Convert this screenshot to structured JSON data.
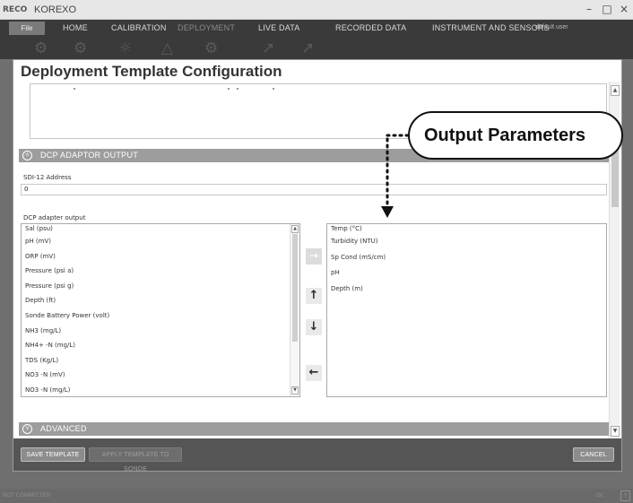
{
  "window": {
    "logo": "RECO",
    "title": "KOREXO",
    "minimize": "–",
    "maximize": "□",
    "close": "×"
  },
  "ribbon": {
    "file": "File",
    "tabs": [
      {
        "label": "HOME"
      },
      {
        "label": "CALIBRATION"
      },
      {
        "label": "DEPLOYMENT"
      },
      {
        "label": "LIVE DATA"
      },
      {
        "label": "RECORDED DATA"
      },
      {
        "label": "INSTRUMENT AND SENSORS"
      }
    ],
    "user": "default user"
  },
  "dialog": {
    "title": "Deployment Template Configuration",
    "dcp_section": "DCP ADAPTOR OUTPUT",
    "sdi_label": "SDI-12 Address",
    "sdi_value": "0",
    "dcp_output_label": "DCP adapter output",
    "available_parameters": [
      "Sal (psu)",
      "pH (mV)",
      "ORP (mV)",
      "Pressure (psi a)",
      "Pressure (psi g)",
      "Depth (ft)",
      "Sonde Battery Power (volt)",
      "NH3 (mg/L)",
      "NH4+ -N (mg/L)",
      "TDS (Kg/L)",
      "NO3 -N (mV)",
      "NO3 -N (mg/L)"
    ],
    "selected_parameters": [
      "Temp (°C)",
      "Turbidity (NTU)",
      "Sp Cond (mS/cm)",
      "pH",
      "Depth (m)"
    ],
    "move_buttons": {
      "add": "→",
      "up": "↑",
      "down": "↓",
      "remove": "←"
    },
    "advanced_section": "ADVANCED",
    "save_button": "SAVE TEMPLATE",
    "apply_button": "APPLY TEMPLATE TO SONDE",
    "cancel_button": "CANCEL"
  },
  "status": {
    "left": "NOT CONNECTED",
    "right": "OC",
    "help": "?"
  },
  "callout": {
    "text": "Output Parameters"
  }
}
